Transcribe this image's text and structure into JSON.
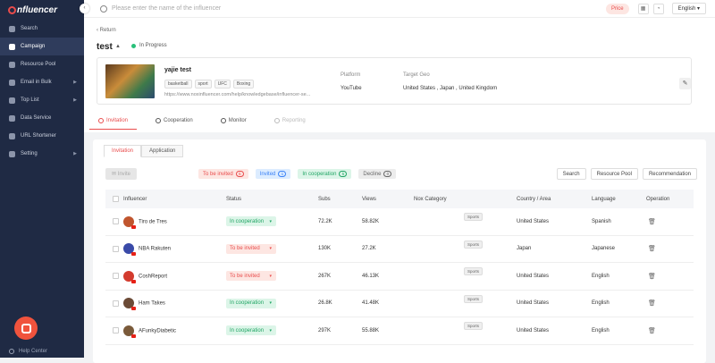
{
  "app": {
    "logo": "nfluencer",
    "collapse_icon": "chevron-left-icon"
  },
  "sidebar": {
    "items": [
      {
        "label": "Search",
        "icon": "search-icon",
        "active": false,
        "arrow": false
      },
      {
        "label": "Campaign",
        "icon": "campaign-icon",
        "active": true,
        "arrow": false
      },
      {
        "label": "Resource Pool",
        "icon": "heart-icon",
        "active": false,
        "arrow": false
      },
      {
        "label": "Email in Bulk",
        "icon": "mail-icon",
        "active": false,
        "arrow": true
      },
      {
        "label": "Top List",
        "icon": "list-icon",
        "active": false,
        "arrow": true
      },
      {
        "label": "Data Service",
        "icon": "data-icon",
        "active": false,
        "arrow": false
      },
      {
        "label": "URL Shortener",
        "icon": "link-icon",
        "active": false,
        "arrow": false
      },
      {
        "label": "Setting",
        "icon": "gear-icon",
        "active": false,
        "arrow": true
      }
    ],
    "help_label": "Help Center"
  },
  "topbar": {
    "search_placeholder": "Please enter the name of the influencer",
    "price_label": "Price",
    "language": "English"
  },
  "campaign": {
    "return_label": "Return",
    "title": "test",
    "status": "In Progress",
    "status_color": "#28c07a"
  },
  "card": {
    "name": "yajie test",
    "tags": [
      "basketball",
      "sport",
      "UFC",
      "Boxing"
    ],
    "url": "https://www.noxinfluencer.com/help/knowledgebase/influencer-se...",
    "platform_label": "Platform",
    "platform_value": "YouTube",
    "geo_label": "Target Geo",
    "geo_values": [
      "United States",
      "Japan",
      "United Kingdom"
    ]
  },
  "tabs": [
    {
      "label": "Invitation",
      "icon": "user-icon",
      "state": "active"
    },
    {
      "label": "Cooperation",
      "icon": "handshake-icon",
      "state": "normal"
    },
    {
      "label": "Monitor",
      "icon": "monitor-icon",
      "state": "normal"
    },
    {
      "label": "Reporting",
      "icon": "report-icon",
      "state": "disabled"
    }
  ],
  "subtabs": [
    {
      "label": "Invitation",
      "active": true
    },
    {
      "label": "Application",
      "active": false
    }
  ],
  "toolbar": {
    "invite_label": "Invite",
    "filters": [
      {
        "label": "To be invited",
        "count": "5",
        "cls": "f1"
      },
      {
        "label": "Invited",
        "count": "1",
        "cls": "f2"
      },
      {
        "label": "In cooperation",
        "count": "5",
        "cls": "f3"
      },
      {
        "label": "Decline",
        "count": "0",
        "cls": "f4"
      }
    ],
    "right_buttons": [
      "Search",
      "Resource Pool",
      "Recommendation"
    ]
  },
  "table": {
    "columns": [
      "Influencer",
      "Status",
      "Subs",
      "Views",
      "Nox Category",
      "Country / Area",
      "Language",
      "Operation"
    ],
    "rows": [
      {
        "name": "Tiro de Tres",
        "status": "In cooperation",
        "scls": "s-coop",
        "subs": "72.2K",
        "views": "58.82K",
        "cat": "Sports",
        "country": "United States",
        "lang": "Spanish",
        "avatar": "#c0552e"
      },
      {
        "name": "NBA Rakuten",
        "status": "To be invited",
        "scls": "s-inv",
        "subs": "130K",
        "views": "27.2K",
        "cat": "Sports",
        "country": "Japan",
        "lang": "Japanese",
        "avatar": "#3a4aa8"
      },
      {
        "name": "CoshReport",
        "status": "To be invited",
        "scls": "s-inv",
        "subs": "267K",
        "views": "46.13K",
        "cat": "Sports",
        "country": "United States",
        "lang": "English",
        "avatar": "#d33b2e"
      },
      {
        "name": "Ham Takes",
        "status": "In cooperation",
        "scls": "s-coop",
        "subs": "26.8K",
        "views": "41.48K",
        "cat": "Sports",
        "country": "United States",
        "lang": "English",
        "avatar": "#6b4a36"
      },
      {
        "name": "AFunkyDiabetic",
        "status": "In cooperation",
        "scls": "s-coop",
        "subs": "297K",
        "views": "55.88K",
        "cat": "Sports",
        "country": "United States",
        "lang": "English",
        "avatar": "#7a5a3a"
      }
    ]
  }
}
